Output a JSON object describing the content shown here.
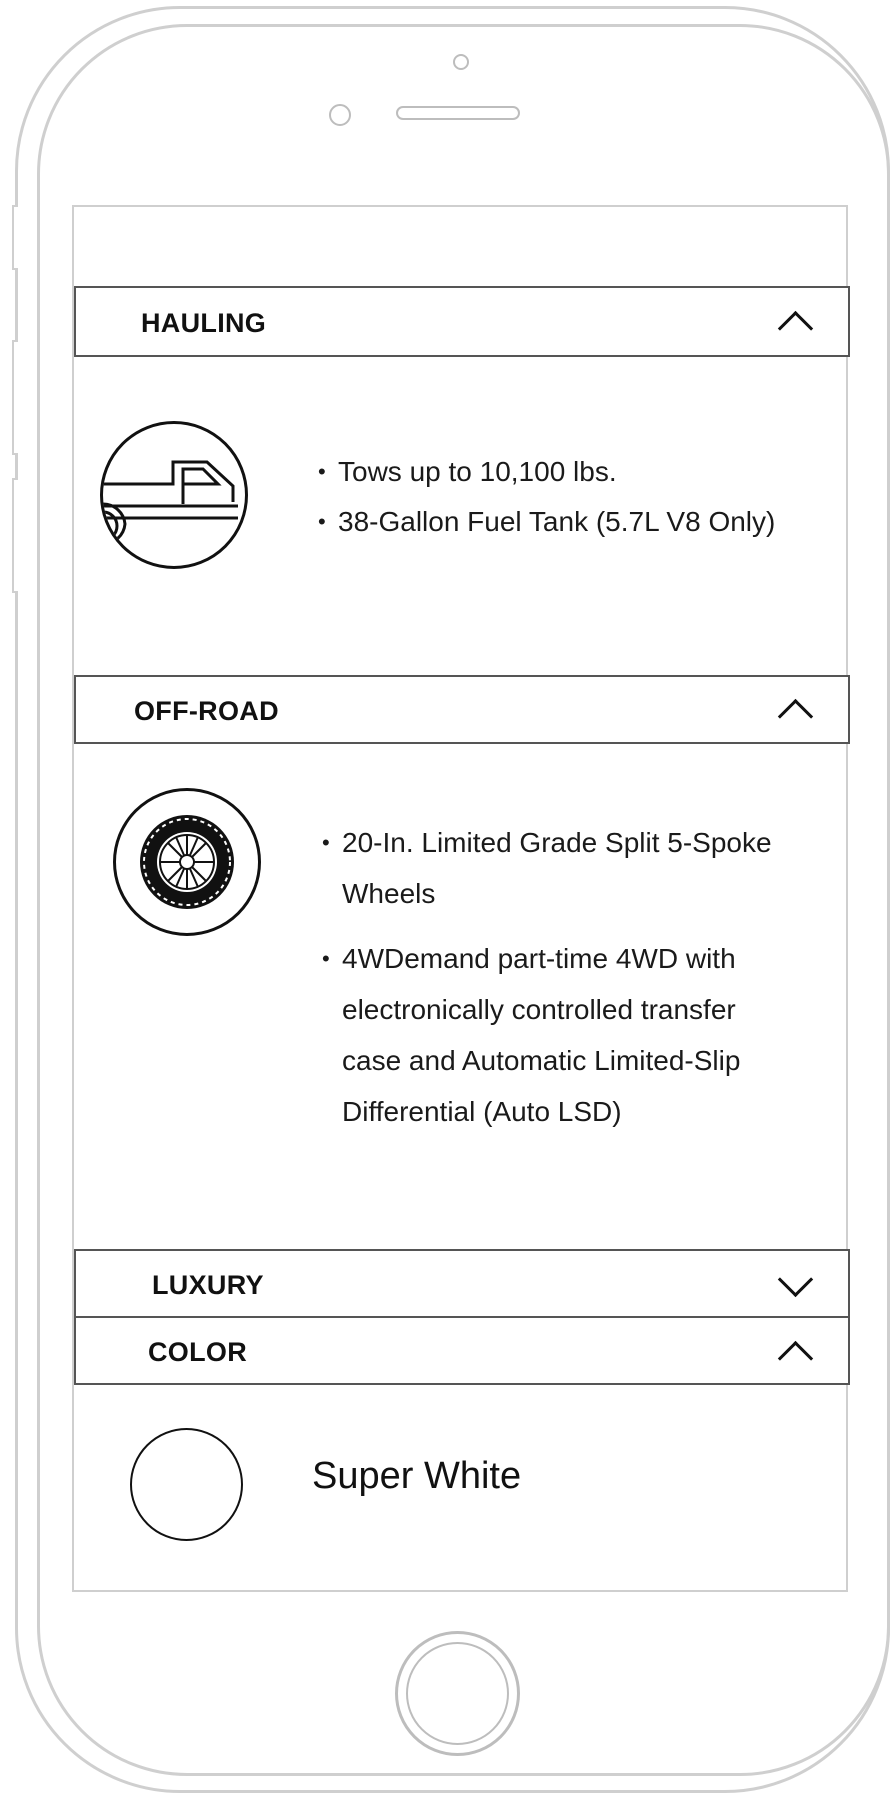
{
  "sections": [
    {
      "title": "HAULING",
      "expanded": true,
      "icon": "pickup-truck-icon",
      "bullets": [
        "Tows up to 10,100 lbs.",
        "38-Gallon Fuel Tank (5.7L V8 Only)"
      ]
    },
    {
      "title": "OFF-ROAD",
      "expanded": true,
      "icon": "tire-wheel-icon",
      "bullets": [
        "20-In. Limited Grade Split 5-Spoke Wheels",
        "4WDemand part-time 4WD with electronically controlled transfer case and Automatic Limited-Slip Differential (Auto LSD)"
      ]
    },
    {
      "title": "LUXURY",
      "expanded": false
    },
    {
      "title": "COLOR",
      "expanded": true,
      "swatch_color": "#ffffff",
      "color_name": "Super White"
    }
  ],
  "colors": {
    "border": "#555555",
    "frame": "#cfcfcf",
    "text": "#1a1a1a"
  }
}
